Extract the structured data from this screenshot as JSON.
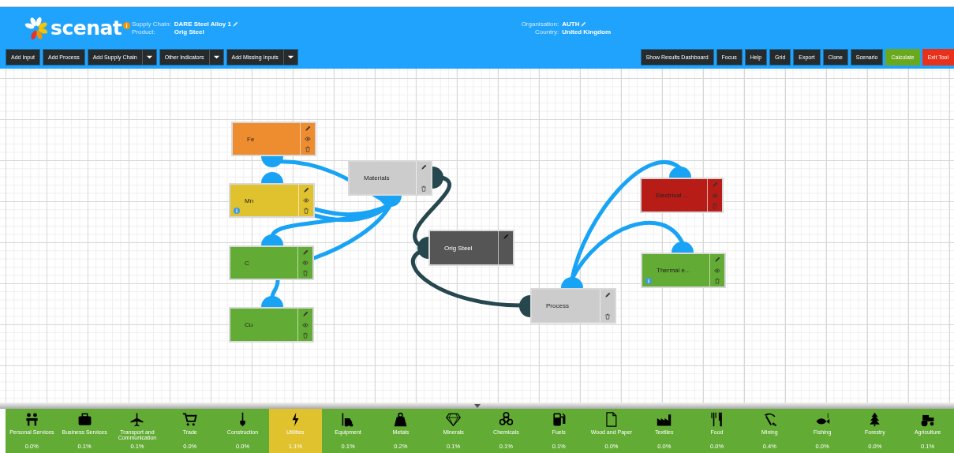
{
  "header": {
    "logo": "scenat",
    "supply_chain": {
      "label": "Supply Chain:",
      "value": "DARE Steel Alloy 1",
      "editable": true
    },
    "product": {
      "label": "Product:",
      "value": "Orig Steel",
      "editable": false
    },
    "organisation": {
      "label": "Organisation:",
      "value": "AUTH",
      "editable": true
    },
    "country": {
      "label": "Country:",
      "value": "United Kingdom",
      "editable": false
    }
  },
  "toolbar": {
    "left": [
      {
        "label": "Add Input",
        "dropdown": false
      },
      {
        "label": "Add Process",
        "dropdown": false
      },
      {
        "label": "Add Supply Chain",
        "dropdown": true
      },
      {
        "label": "Other Indicators",
        "dropdown": true
      },
      {
        "label": "Add Missing Inputs",
        "dropdown": true
      }
    ],
    "right": [
      {
        "label": "Show Results Dashboard",
        "kind": "plain"
      },
      {
        "label": "Focus",
        "kind": "plain"
      },
      {
        "label": "Help",
        "kind": "plain"
      },
      {
        "label": "Grid",
        "kind": "plain"
      },
      {
        "label": "Export",
        "kind": "plain"
      },
      {
        "label": "Clone",
        "kind": "plain"
      },
      {
        "label": "Scenario",
        "kind": "plain"
      },
      {
        "label": "Calculate",
        "kind": "confirm"
      },
      {
        "label": "Exit Tool",
        "kind": "exit"
      }
    ]
  },
  "nodes": [
    {
      "label": "Fe",
      "kind": "input",
      "color": "#ee8c30",
      "info": false
    },
    {
      "label": "Mn",
      "kind": "input",
      "color": "#e0c12e",
      "info": true
    },
    {
      "label": "C",
      "kind": "input",
      "color": "#62ab34",
      "info": false
    },
    {
      "label": "Cu",
      "kind": "input",
      "color": "#62ab34",
      "info": false
    },
    {
      "label": "Materials",
      "kind": "process",
      "color": "#cccccc",
      "info": false
    },
    {
      "label": "Orig Steel",
      "kind": "product",
      "color": "#555555",
      "info": false
    },
    {
      "label": "Process",
      "kind": "process",
      "color": "#cccccc",
      "info": false
    },
    {
      "label": "Electrical ...",
      "kind": "input",
      "color": "#b71c17",
      "info": false
    },
    {
      "label": "Thermal e...",
      "kind": "input",
      "color": "#62ab34",
      "info": true
    }
  ],
  "categories": [
    {
      "label": "Personal Services",
      "value": "0.0%",
      "selected": false
    },
    {
      "label": "Business Services",
      "value": "0.1%",
      "selected": false
    },
    {
      "label": "Transport and Communication",
      "value": "0.1%",
      "selected": false
    },
    {
      "label": "Trade",
      "value": "0.0%",
      "selected": false
    },
    {
      "label": "Construction",
      "value": "0.0%",
      "selected": false
    },
    {
      "label": "Utilities",
      "value": "1.1%",
      "selected": true
    },
    {
      "label": "Equipment",
      "value": "0.1%",
      "selected": false
    },
    {
      "label": "Metals",
      "value": "0.2%",
      "selected": false
    },
    {
      "label": "Minerals",
      "value": "0.1%",
      "selected": false
    },
    {
      "label": "Chemicals",
      "value": "0.1%",
      "selected": false
    },
    {
      "label": "Fuels",
      "value": "0.1%",
      "selected": false
    },
    {
      "label": "Wood and Paper",
      "value": "0.0%",
      "selected": false
    },
    {
      "label": "Textiles",
      "value": "0.0%",
      "selected": false
    },
    {
      "label": "Food",
      "value": "0.0%",
      "selected": false
    },
    {
      "label": "Mining",
      "value": "0.4%",
      "selected": false
    },
    {
      "label": "Fishing",
      "value": "0.0%",
      "selected": false
    },
    {
      "label": "Forestry",
      "value": "0.0%",
      "selected": false
    },
    {
      "label": "Agriculture",
      "value": "0.1%",
      "selected": false
    }
  ]
}
